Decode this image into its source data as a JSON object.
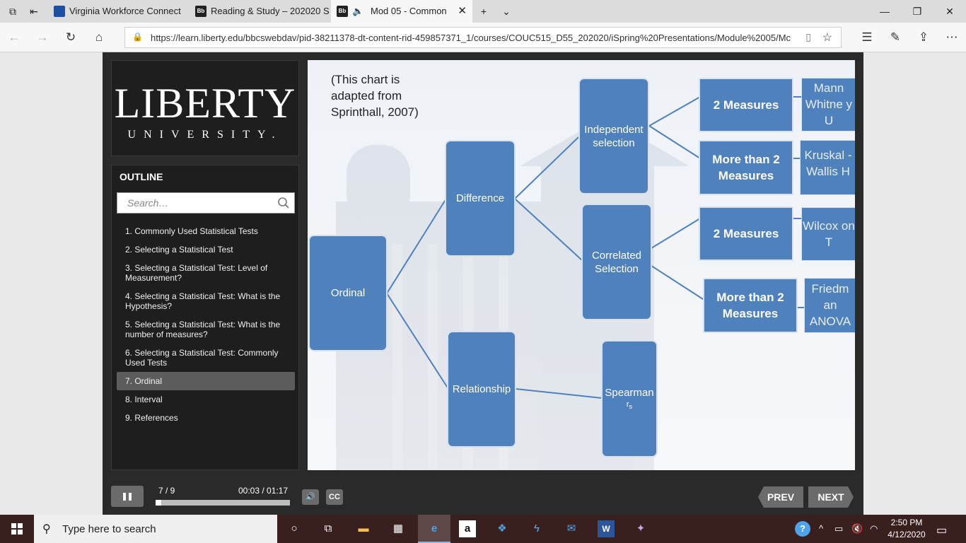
{
  "browser": {
    "tabs": [
      {
        "title": "Virginia Workforce Connect",
        "favicon": "virginia-favicon"
      },
      {
        "title": "Reading & Study – 202020 S",
        "favicon": "blackboard-favicon"
      },
      {
        "title": "Mod 05 - Common",
        "favicon": "blackboard-favicon"
      }
    ],
    "url": "https://learn.liberty.edu/bbcswebdav/pid-38211378-dt-content-rid-459857371_1/courses/COUC515_D55_202020/iSpring%20Presentations/Module%2005/Mc"
  },
  "player": {
    "logo": {
      "main": "LIBERTY",
      "sub": "UNIVERSITY."
    },
    "outline": {
      "title": "OUTLINE",
      "search_placeholder": "Search…",
      "items": [
        "1. Commonly Used Statistical Tests",
        "2. Selecting a Statistical Test",
        "3. Selecting a Statistical Test: Level of Measurement?",
        "4. Selecting a Statistical Test: What is the Hypothesis?",
        "5. Selecting a Statistical Test: What is the number of measures?",
        "6. Selecting a Statistical Test: Commonly Used Tests",
        "7. Ordinal",
        "8. Interval",
        "9. References"
      ],
      "active_index": 6
    },
    "slide": {
      "note": "(This chart is adapted from Sprinthall, 2007)",
      "nodes": {
        "ordinal": "Ordinal",
        "difference": "Difference",
        "relationship": "Relationship",
        "independent": "Independent selection",
        "correlated": "Correlated Selection",
        "spearman": "Spearman",
        "spearman_sub": "s",
        "ind_two": "2 Measures",
        "ind_more": "More than 2 Measures",
        "cor_two": "2 Measures",
        "cor_more": "More than 2 Measures",
        "mann": "Mann Whitne y U",
        "kruskal": "Kruskal - Wallis H",
        "wilcoxon": "Wilcox on T",
        "friedman": "Friedm an ANOVA"
      }
    },
    "controls": {
      "slide_counter": "7 / 9",
      "time": "00:03 / 01:17",
      "progress_fraction": 0.04,
      "cc_label": "CC",
      "prev_label": "PREV",
      "next_label": "NEXT"
    }
  },
  "taskbar": {
    "search_text": "Type here to search",
    "time": "2:50 PM",
    "date": "4/12/2020"
  }
}
